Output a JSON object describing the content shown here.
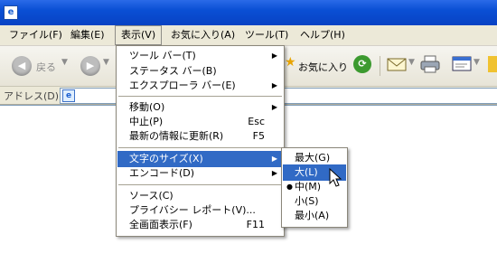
{
  "titlebar": {
    "icon": "ie-logo-icon"
  },
  "menubar": [
    {
      "label": "ファイル(F)"
    },
    {
      "label": "編集(E)"
    },
    {
      "label": "表示(V)"
    },
    {
      "label": "お気に入り(A)"
    },
    {
      "label": "ツール(T)"
    },
    {
      "label": "ヘルプ(H)"
    }
  ],
  "toolbar": {
    "back_label": "戻る",
    "favorites_label": "お気に入り"
  },
  "address": {
    "label": "アドレス(D)"
  },
  "view_menu": {
    "items": [
      {
        "label": "ツール バー(T)",
        "shortcut": "",
        "submenu": true
      },
      {
        "label": "ステータス バー(B)",
        "shortcut": "",
        "submenu": false
      },
      {
        "label": "エクスプローラ バー(E)",
        "shortcut": "",
        "submenu": true
      },
      {
        "label": "移動(O)",
        "shortcut": "",
        "submenu": true
      },
      {
        "label": "中止(P)",
        "shortcut": "Esc",
        "submenu": false
      },
      {
        "label": "最新の情報に更新(R)",
        "shortcut": "F5",
        "submenu": false
      },
      {
        "label": "文字のサイズ(X)",
        "shortcut": "",
        "submenu": true,
        "highlighted": true
      },
      {
        "label": "エンコード(D)",
        "shortcut": "",
        "submenu": true
      },
      {
        "label": "ソース(C)",
        "shortcut": "",
        "submenu": false
      },
      {
        "label": "プライバシー レポート(V)...",
        "shortcut": "",
        "submenu": false
      },
      {
        "label": "全画面表示(F)",
        "shortcut": "F11",
        "submenu": false
      }
    ]
  },
  "text_size_menu": {
    "items": [
      {
        "label": "最大(G)"
      },
      {
        "label": "大(L)",
        "highlighted": true
      },
      {
        "label": "中(M)",
        "selected": true
      },
      {
        "label": "小(S)"
      },
      {
        "label": "最小(A)"
      }
    ]
  },
  "colors": {
    "titlebar": "#0a4fd4",
    "menu_highlight": "#316ac5",
    "menubar_bg": "#ece9d8"
  }
}
